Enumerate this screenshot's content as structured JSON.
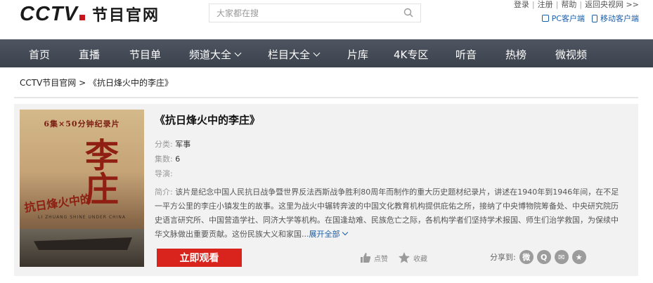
{
  "header": {
    "logo_text": "CCTV",
    "logo_sub": "节目官网",
    "search_placeholder": "大家都在搜",
    "top_links": [
      "登录",
      "注册",
      "帮助",
      "返回央视网 >>"
    ],
    "client_links": [
      "PC客户端",
      "移动客户端"
    ]
  },
  "nav": {
    "items": [
      {
        "label": "首页",
        "dropdown": false
      },
      {
        "label": "直播",
        "dropdown": false
      },
      {
        "label": "节目单",
        "dropdown": false
      },
      {
        "label": "频道大全",
        "dropdown": true
      },
      {
        "label": "栏目大全",
        "dropdown": true
      },
      {
        "label": "片库",
        "dropdown": false
      },
      {
        "label": "4K专区",
        "dropdown": false
      },
      {
        "label": "听音",
        "dropdown": false
      },
      {
        "label": "热榜",
        "dropdown": false
      },
      {
        "label": "微视频",
        "dropdown": false
      }
    ]
  },
  "breadcrumb": "CCTV节目官网 > 《抗日烽火中的李庄》",
  "program": {
    "title": "《抗日烽火中的李庄》",
    "category_label": "分类:",
    "category": "军事",
    "episodes_label": "集数:",
    "episodes": "6",
    "director_label": "导演:",
    "director": "",
    "desc_label": "简介:",
    "description": "该片是纪念中国人民抗日战争暨世界反法西斯战争胜利80周年而制作的重大历史题材纪录片，讲述在1940年到1946年间，在不足一平方公里的李庄小镇发生的故事。这里为战火中辗转奔波的中国文化教育机构提供庇佑之所，接纳了中央博物院筹备处、中央研究院历史语言研究所、中国营造学社、同济大学等机构。在国逢劫难、民族危亡之际，各机构学者们坚持学术报国、师生们治学救国，为保续中华文脉做出重要贡献。这份民族大义和家国...",
    "expand_label": "展开全部",
    "poster": {
      "top_text": "6集×50分钟纪录片",
      "title_text": "李庄",
      "sub_text": "抗日烽火中的",
      "en_text": "LI ZHUANG SHINE UNDER CHINA"
    }
  },
  "actions": {
    "watch_label": "立即观看",
    "like_label": "点赞",
    "favorite_label": "收藏",
    "share_label": "分享到:",
    "share_icons": [
      "weibo-icon",
      "qq-icon",
      "wechat-icon",
      "qzone-icon"
    ]
  },
  "colors": {
    "brand_red": "#d8241d",
    "nav_bg": "#434a55",
    "link_blue": "#1d5fa8"
  }
}
